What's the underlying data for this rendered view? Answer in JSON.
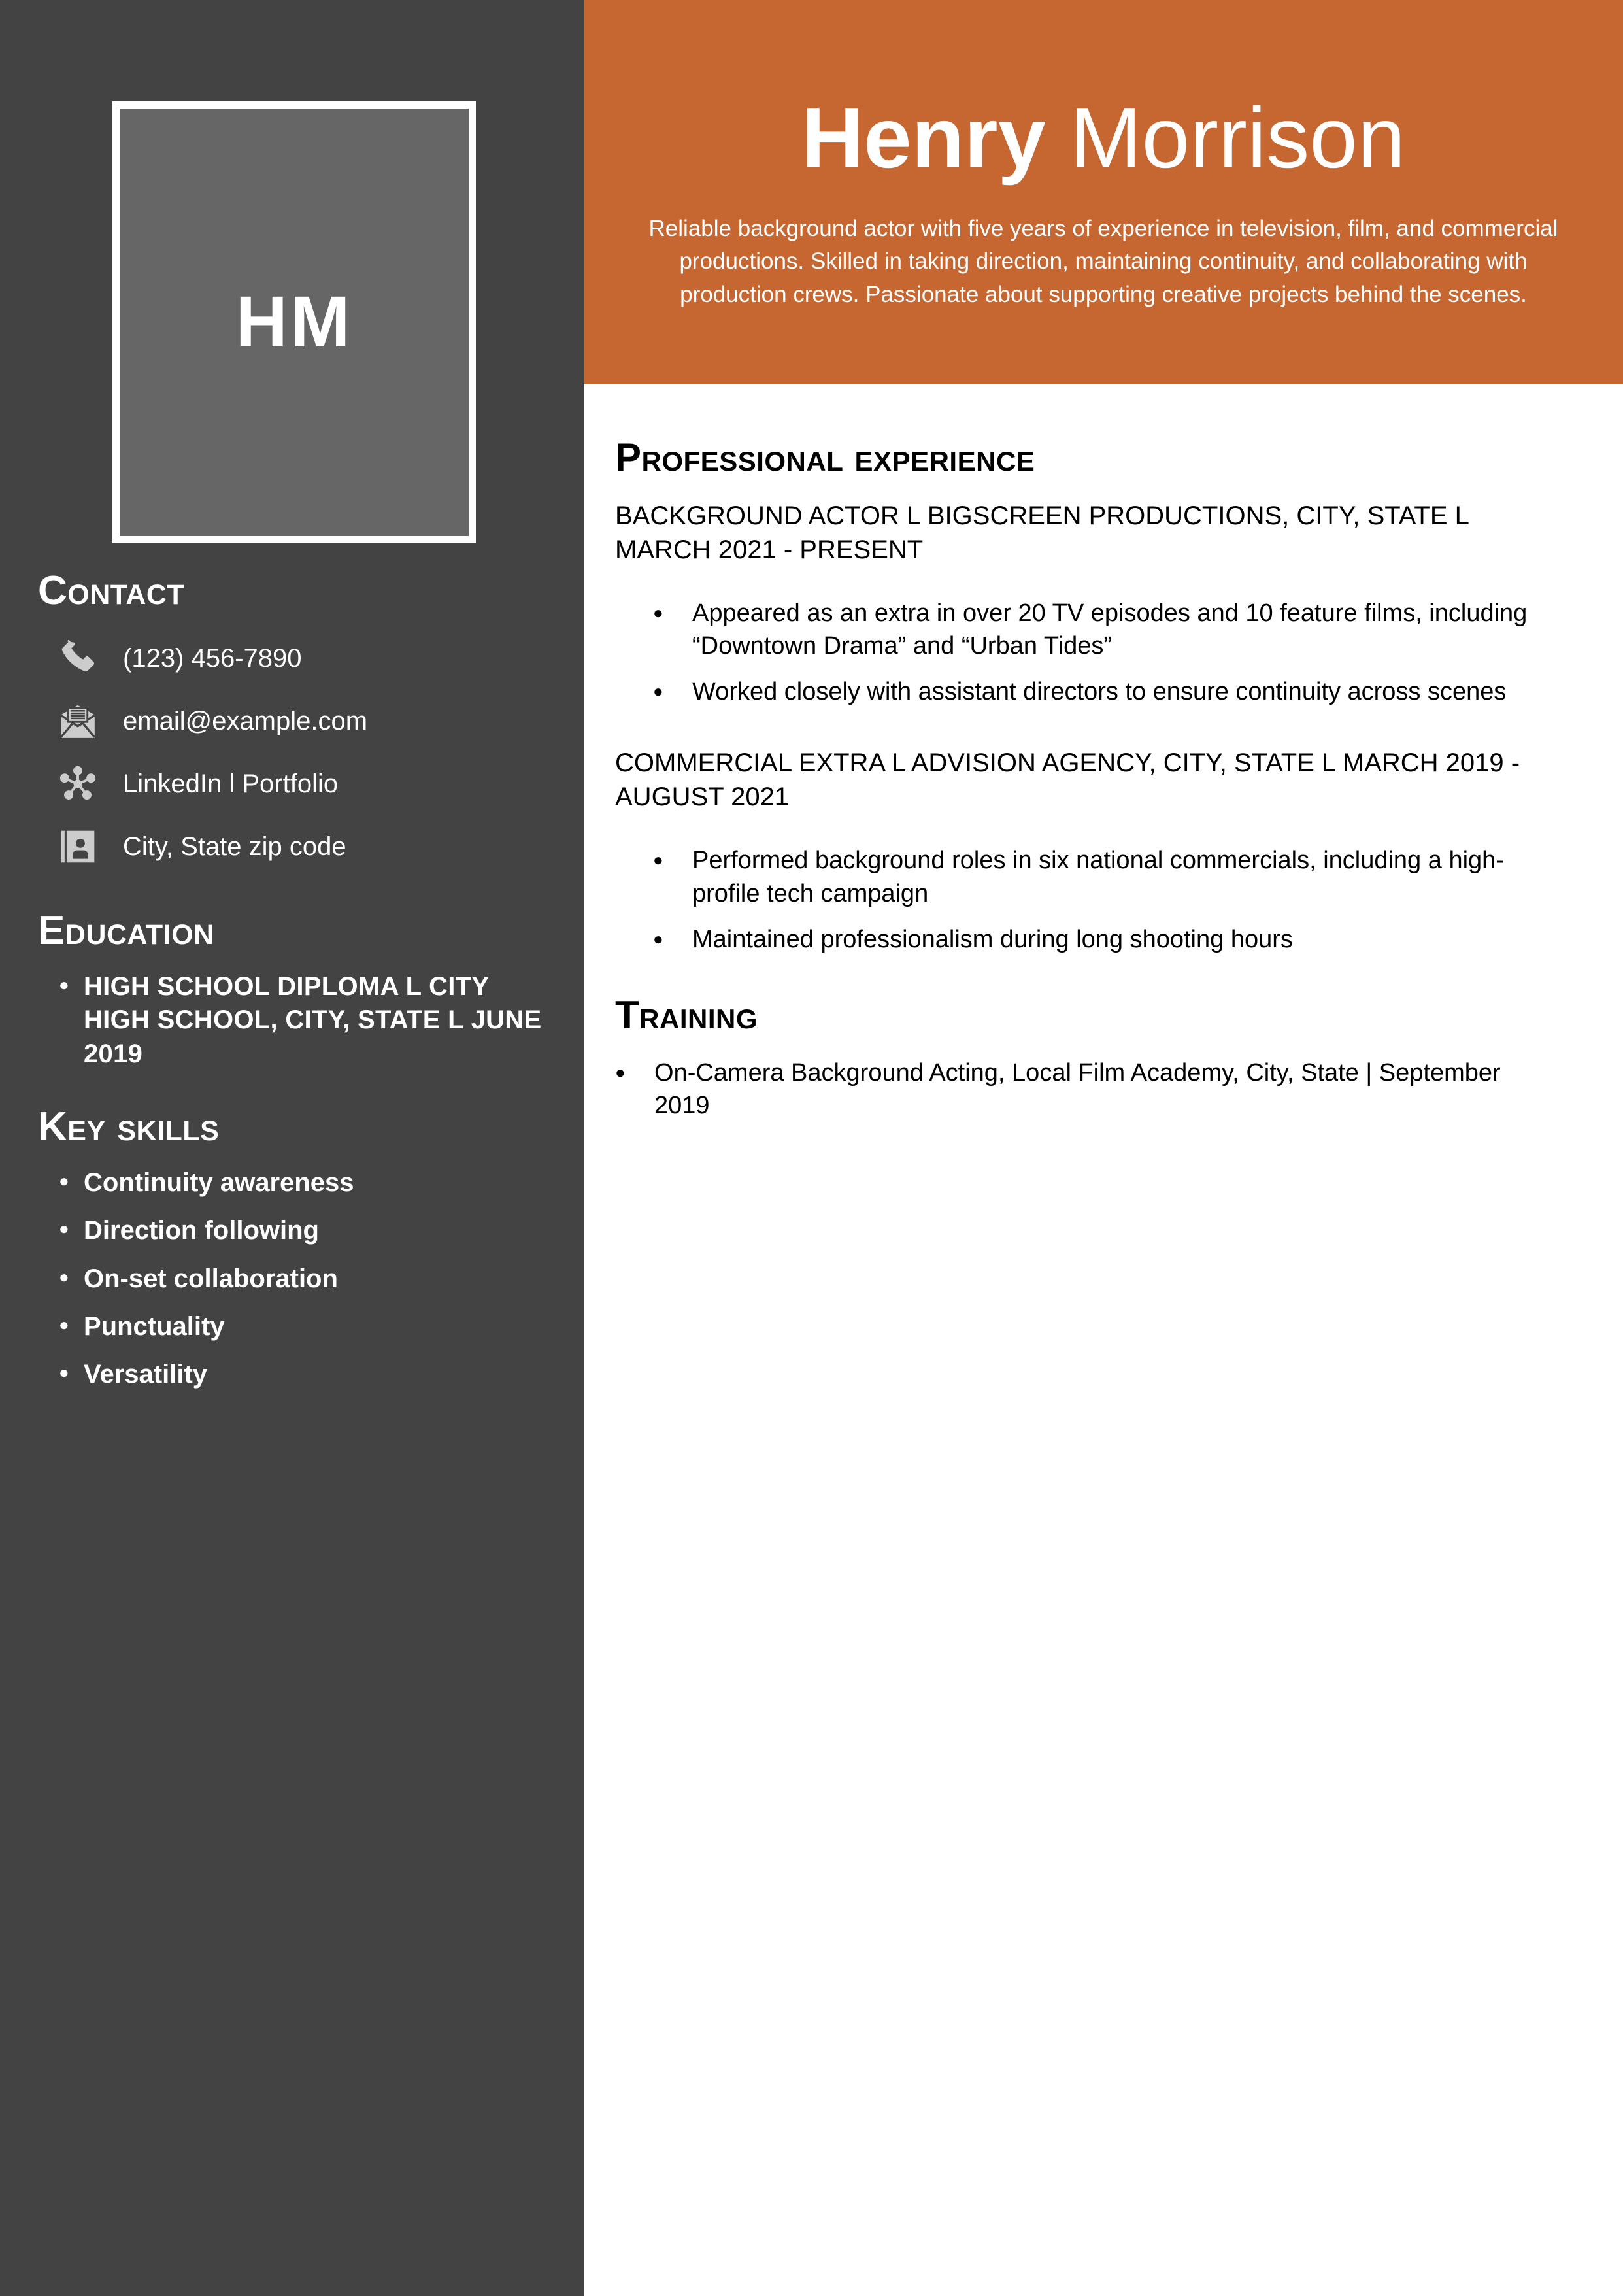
{
  "colors": {
    "accent_orange": "#c66630",
    "sidebar_dark": "#434343",
    "photo_gray": "#666666",
    "icon_gray": "#cccccc",
    "text_white": "#ffffff",
    "text_black": "#000000"
  },
  "photo": {
    "initials": "HM"
  },
  "header": {
    "first_name": "Henry",
    "last_name": " Morrison",
    "summary": "Reliable background actor with five years of experience in television, film, and commercial productions. Skilled in taking direction, maintaining continuity, and collaborating with production crews. Passionate about supporting creative projects behind the scenes."
  },
  "sidebar": {
    "contact": {
      "heading": "Contact",
      "items": [
        {
          "icon": "phone-icon",
          "value": "(123) 456-7890"
        },
        {
          "icon": "envelope-icon",
          "value": "email@example.com"
        },
        {
          "icon": "network-share-icon",
          "value": "LinkedIn l Portfolio"
        },
        {
          "icon": "contact-card-icon",
          "value": "City, State zip code"
        }
      ]
    },
    "education": {
      "heading": "Education",
      "items": [
        "HIGH SCHOOL DIPLOMA l CITY HIGH SCHOOL, CITY, STATE l JUNE 2019"
      ]
    },
    "key_skills": {
      "heading": "Key skills",
      "items": [
        "Continuity awareness",
        "Direction following",
        "On-set collaboration",
        "Punctuality",
        "Versatility"
      ]
    }
  },
  "main": {
    "experience": {
      "heading": "Professional experience",
      "jobs": [
        {
          "title": "BACKGROUND ACTOR l BIGSCREEN PRODUCTIONS, CITY, STATE l MARCH 2021 - PRESENT",
          "bullets": [
            "Appeared as an extra in over 20 TV episodes and 10 feature films, including “Downtown Drama” and “Urban Tides”",
            "Worked closely with assistant directors to ensure continuity across scenes"
          ]
        },
        {
          "title": "COMMERCIAL EXTRA l ADVISION AGENCY, CITY, STATE l MARCH 2019 - AUGUST 2021",
          "bullets": [
            "Performed background roles in six national commercials, including a high-profile tech campaign",
            "Maintained professionalism during long shooting hours"
          ]
        }
      ]
    },
    "training": {
      "heading": "Training",
      "items": [
        "On-Camera Background Acting, Local Film Academy, City, State | September 2019"
      ]
    }
  }
}
